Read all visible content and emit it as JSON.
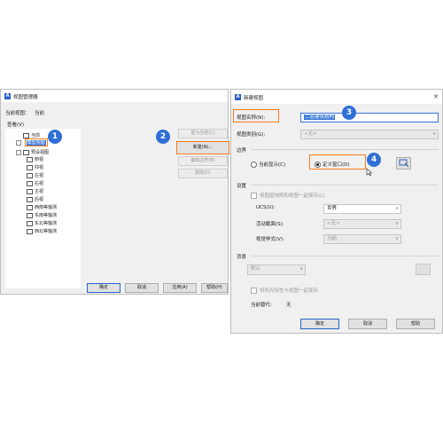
{
  "left_dialog": {
    "title": "视图管理器",
    "current_view_label": "当前视图：",
    "current_view_value": "当前",
    "views_label": "查看(V)",
    "tree": {
      "current": "当前",
      "model_views": "模型视图",
      "preset_views": "预设视图",
      "items": [
        "俯视",
        "仰视",
        "左视",
        "右视",
        "主视",
        "后视",
        "西南等轴测",
        "东南等轴测",
        "东北等轴测",
        "西北等轴测"
      ]
    },
    "side_buttons": {
      "set_current": "置为当前(C)",
      "new": "新建(N)...",
      "edit_boundary": "编辑边界(B)",
      "delete": "删除(D)"
    },
    "footer_buttons": {
      "ok": "确定",
      "cancel": "取消",
      "apply": "应用(A)",
      "help": "帮助(H)"
    }
  },
  "right_dialog": {
    "title": "新建视图",
    "close_glyph": "✕",
    "view_name_label": "视图名称(N):",
    "view_name_value": "二层建筑结构",
    "view_category_label": "视图类别(G):",
    "view_category_value": "<无>",
    "boundary_group": "边界",
    "radio_current_display": "当前显示(C)",
    "radio_define_window": "定义窗口(D)",
    "settings_group": "设置",
    "save_layer_snapshot": "将图层快照和视图一起保存(L)",
    "ucs_label": "UCS(U):",
    "ucs_value": "世界",
    "live_section_label": "活动截面(S):",
    "live_section_value": "<无>",
    "visual_style_label": "视觉样式(V):",
    "visual_style_value": "当前",
    "background_group": "背景",
    "background_value": "默认",
    "save_sun_props": "将阳光特性与视图一起保存",
    "current_override_label": "当前替代:",
    "current_override_value": "无",
    "footer_buttons": {
      "ok": "确定",
      "cancel": "取消",
      "help": "帮助"
    }
  },
  "callouts": [
    "1",
    "2",
    "3",
    "4"
  ],
  "colors": {
    "callout_blue": "#2f6fd6",
    "highlight_orange": "#ff7a1a",
    "selection_blue": "#3875d7",
    "app_icon_blue": "#2a62c9"
  },
  "icons": [
    "app-icon",
    "view-icon",
    "close-icon",
    "pick-window-icon",
    "mouse-cursor-icon"
  ]
}
